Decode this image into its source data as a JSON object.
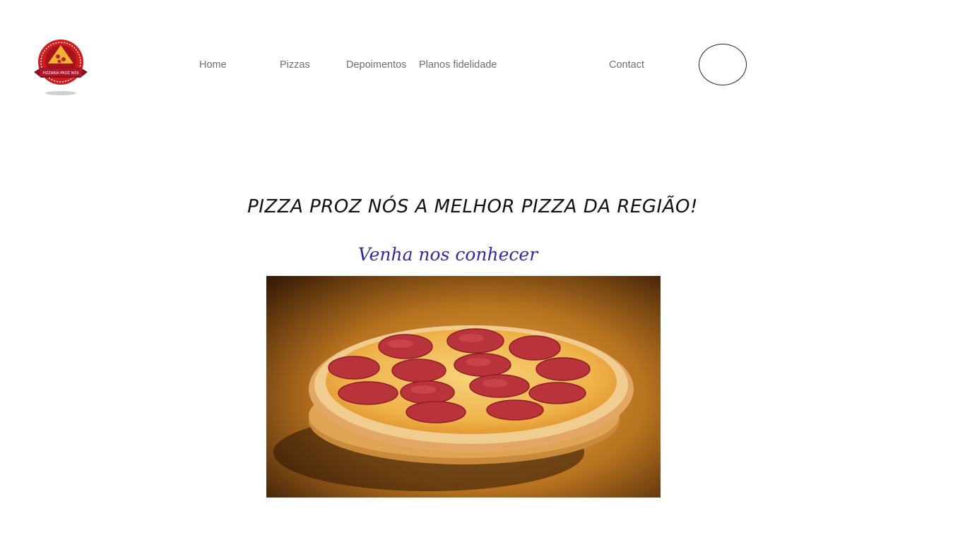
{
  "header": {
    "logo": {
      "icon": "pizza-logo-icon",
      "text": "PIZZARIA PROZ NÓS"
    },
    "nav": [
      {
        "label": "Home"
      },
      {
        "label": "Pizzas"
      },
      {
        "label": "Depoimentos"
      },
      {
        "label": "Planos fidelidade"
      },
      {
        "label": "Contact"
      }
    ],
    "circle_button": {
      "icon": "circle-button"
    }
  },
  "hero": {
    "title": "PIZZA PROZ NÓS A MELHOR PIZZA DA REGIÃO!",
    "subtitle": "Venha nos conhecer",
    "subtitle_color": "#2e2aa8",
    "image": {
      "icon": "pepperoni-pizza-photo"
    }
  },
  "colors": {
    "nav_text": "#6f6f6f",
    "logo_red": "#d41a1a",
    "logo_dark": "#8a1020"
  }
}
